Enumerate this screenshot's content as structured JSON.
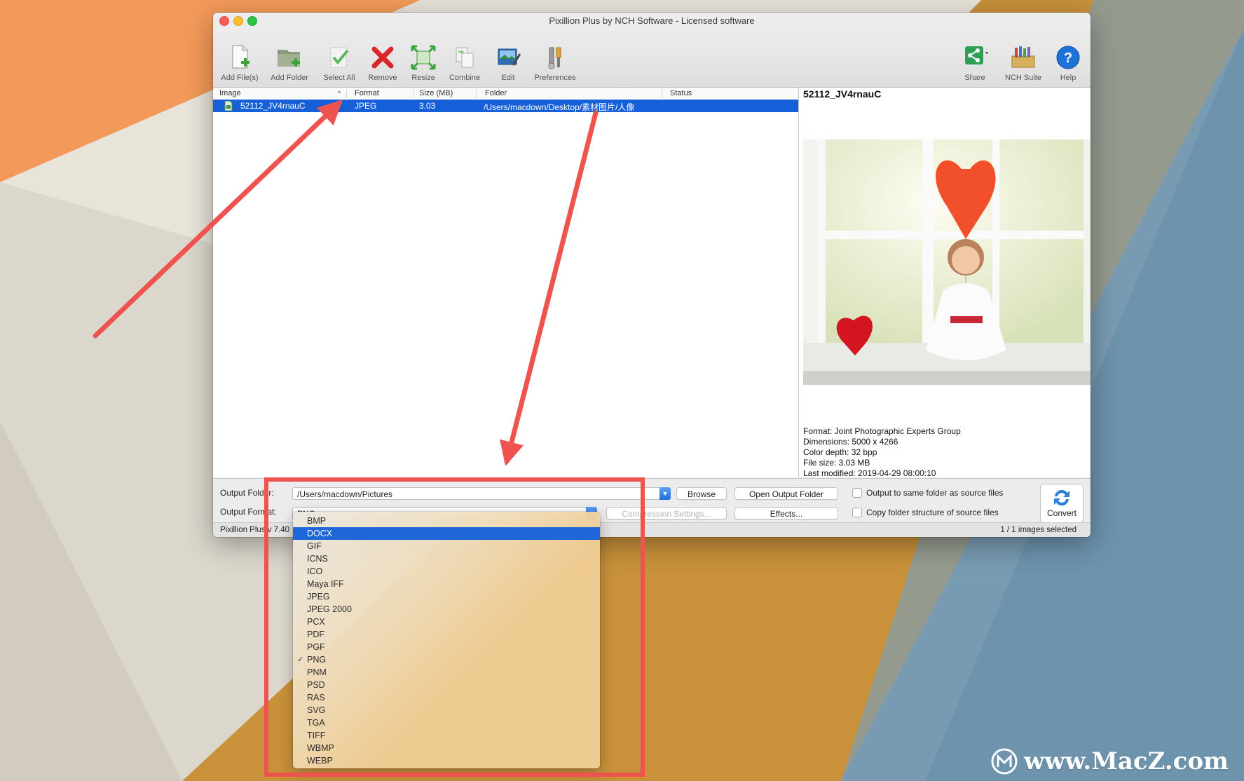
{
  "window": {
    "title": "Pixillion Plus by NCH Software - Licensed software"
  },
  "toolbar": {
    "items": [
      {
        "label": "Add File(s)",
        "icon": "add-file-icon"
      },
      {
        "label": "Add Folder",
        "icon": "add-folder-icon"
      },
      {
        "label": "Select All",
        "icon": "select-all-icon"
      },
      {
        "label": "Remove",
        "icon": "remove-icon"
      },
      {
        "label": "Resize",
        "icon": "resize-icon"
      },
      {
        "label": "Combine",
        "icon": "combine-icon"
      },
      {
        "label": "Edit",
        "icon": "edit-icon"
      },
      {
        "label": "Preferences",
        "icon": "preferences-icon"
      },
      {
        "label": "Share",
        "icon": "share-icon"
      },
      {
        "label": "NCH Suite",
        "icon": "nch-suite-icon"
      },
      {
        "label": "Help",
        "icon": "help-icon"
      }
    ]
  },
  "file_list": {
    "columns": [
      "Image",
      "Format",
      "Size (MB)",
      "Folder",
      "Status"
    ],
    "rows": [
      {
        "image": "52112_JV4rnauC",
        "format": "JPEG",
        "size": "3.03",
        "folder": "/Users/macdown/Desktop/素材图片/人像",
        "status": ""
      }
    ]
  },
  "preview": {
    "title": "52112_JV4rnauC",
    "info": [
      "Format: Joint Photographic Experts Group",
      "Dimensions: 5000 x 4266",
      "Color depth: 32 bpp",
      "File size: 3.03 MB",
      "Last modified: 2019-04-29 08:00:10"
    ]
  },
  "controls": {
    "output_folder_label": "Output Folder:",
    "output_folder_value": "/Users/macdown/Pictures",
    "output_format_label": "Output Format:",
    "output_format_value": "PNG",
    "browse": "Browse",
    "open_output_folder": "Open Output Folder",
    "compression_settings": "Compression Settings...",
    "effects": "Effects...",
    "same_folder": "Output to same folder as source files",
    "copy_structure": "Copy folder structure of source files",
    "convert": "Convert"
  },
  "statusbar": {
    "left": "Pixillion Plus v 7.40",
    "right": "1 / 1 images selected"
  },
  "format_dropdown": {
    "highlighted": "DOCX",
    "checked": "PNG",
    "options": [
      "BMP",
      "DOCX",
      "GIF",
      "ICNS",
      "ICO",
      "Maya IFF",
      "JPEG",
      "JPEG 2000",
      "PCX",
      "PDF",
      "PGF",
      "PNG",
      "PNM",
      "PSD",
      "RAS",
      "SVG",
      "TGA",
      "TIFF",
      "WBMP",
      "WEBP"
    ]
  },
  "watermark": {
    "text": "www.MacZ.com"
  },
  "colors": {
    "selection": "#1560d8",
    "annotation_red": "#ef5350",
    "highlight": "#1f66d8"
  }
}
